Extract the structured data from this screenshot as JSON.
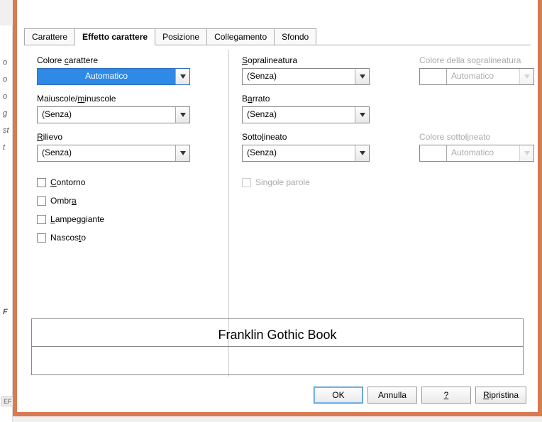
{
  "window": {
    "title": "Carattere"
  },
  "tabs": [
    "Carattere",
    "Effetto carattere",
    "Posizione",
    "Collegamento",
    "Sfondo"
  ],
  "activeTab": 1,
  "left": {
    "colorLabel": "Colore carattere",
    "colorValue": "Automatico",
    "caseLabel": "Maiuscole/minuscole",
    "caseValue": "(Senza)",
    "reliefLabel": "Rilievo",
    "reliefValue": "(Senza)",
    "checks": {
      "outline": "Contorno",
      "shadow": "Ombra",
      "blink": "Lampeggiante",
      "hidden": "Nascosto"
    }
  },
  "right": {
    "overLabel": "Sopralineatura",
    "overValue": "(Senza)",
    "overColorLabel": "Colore della sopralineatura",
    "overColorValue": "Automatico",
    "strikeLabel": "Barrato",
    "strikeValue": "(Senza)",
    "underLabel": "Sottolineato",
    "underValue": "(Senza)",
    "underColorLabel": "Colore sottolineato",
    "underColorValue": "Automatico",
    "singleWords": "Singole parole"
  },
  "preview": {
    "font": "Franklin Gothic Book"
  },
  "buttons": {
    "ok": "OK",
    "cancel": "Annulla",
    "help": "?",
    "reset": "Ripristina"
  },
  "peek": {
    "a": "o",
    "b": "o",
    "c": "o",
    "d": "g",
    "e": "st",
    "f": "t",
    "g": "F",
    "h": "EF"
  }
}
